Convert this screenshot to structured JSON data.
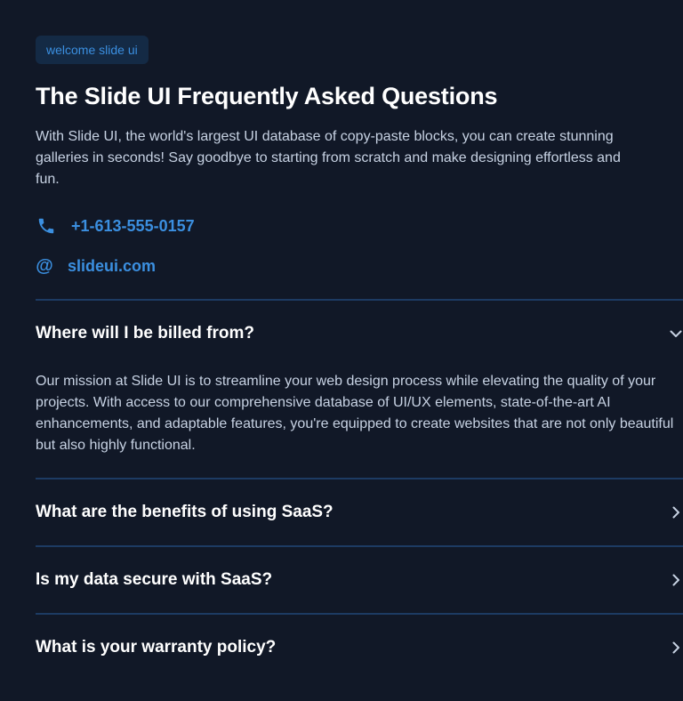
{
  "badge": "welcome slide ui",
  "title": "The Slide UI Frequently Asked Questions",
  "intro": "With Slide UI, the world's largest UI database of copy-paste blocks, you can create stunning galleries in seconds! Say goodbye to starting from scratch and make designing effortless and fun.",
  "contact": {
    "phone": "+1-613-555-0157",
    "website_symbol": "@",
    "website": "slideui.com"
  },
  "faq": [
    {
      "question": "Where will I be billed from?",
      "answer": "Our mission at Slide UI is to streamline your web design process while elevating the quality of your projects. With access to our comprehensive database of UI/UX elements, state-of-the-art AI enhancements, and adaptable features, you're equipped to create websites that are not only beautiful but also highly functional.",
      "expanded": true
    },
    {
      "question": "What are the benefits of using SaaS?",
      "expanded": false
    },
    {
      "question": "Is my data secure with SaaS?",
      "expanded": false
    },
    {
      "question": "What is your warranty policy?",
      "expanded": false
    }
  ],
  "icons": {
    "phone": "phone-icon",
    "website": "at-icon",
    "expanded_chevron": "chevron-down-icon",
    "collapsed_chevron": "chevron-right-icon"
  },
  "colors": {
    "background": "#111827",
    "accent": "#3b8fe0",
    "text": "#ffffff",
    "muted_text": "#c7d2e3",
    "divider": "#1d3b63",
    "badge_bg": "#142a45"
  }
}
